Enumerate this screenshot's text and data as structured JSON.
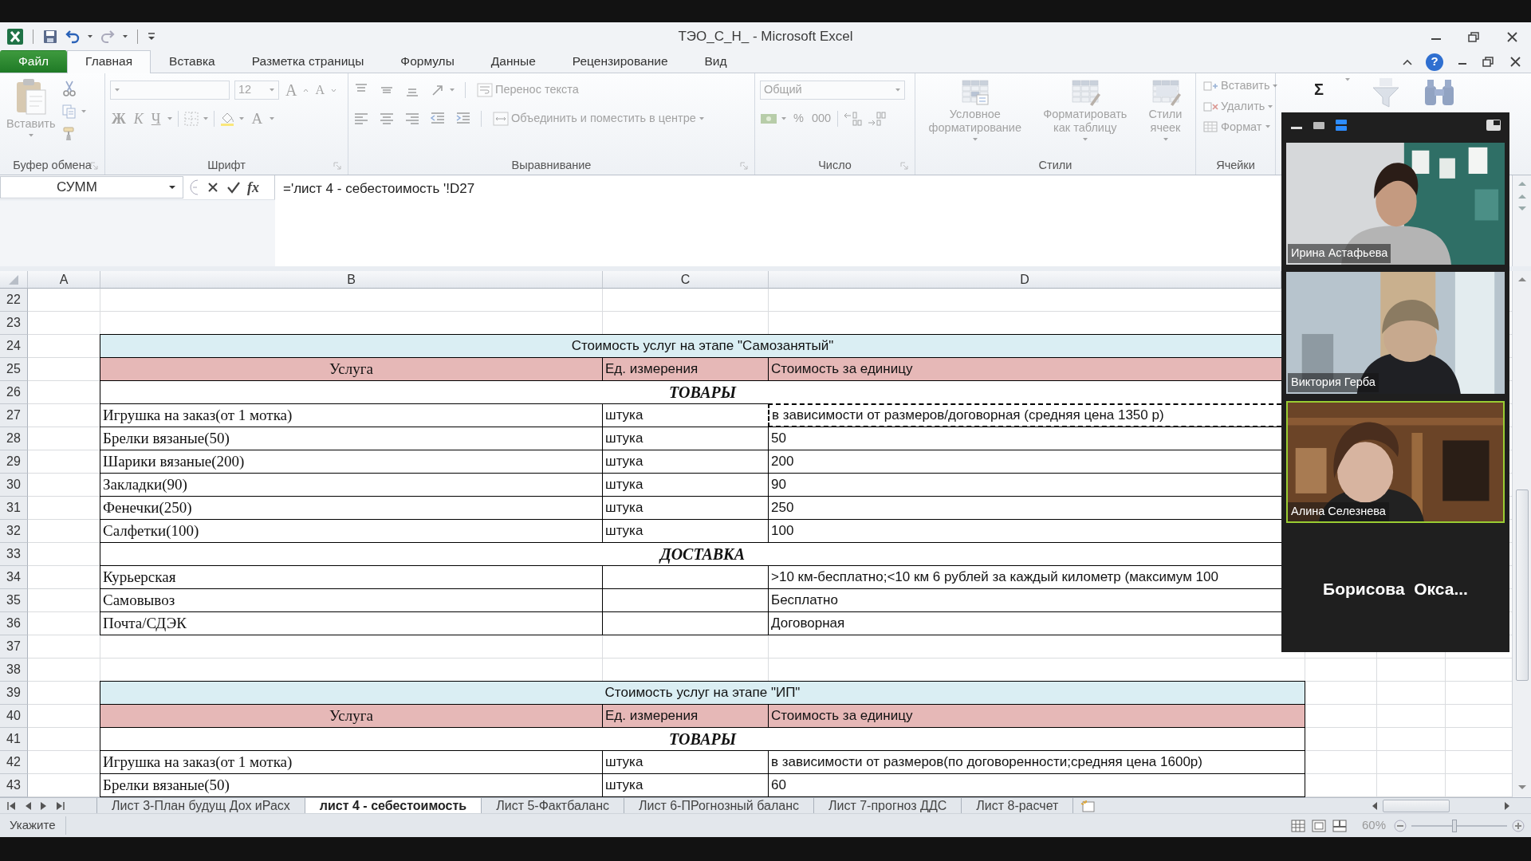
{
  "window": {
    "title": "ТЭО_С_Н_ - Microsoft Excel"
  },
  "ribbon": {
    "disabled": true,
    "help": "?",
    "tabs": [
      {
        "label": "Файл",
        "kind": "file",
        "selected": false
      },
      {
        "label": "Главная",
        "kind": "tab",
        "selected": true
      },
      {
        "label": "Вставка",
        "kind": "tab",
        "selected": false
      },
      {
        "label": "Разметка страницы",
        "kind": "tab",
        "selected": false
      },
      {
        "label": "Формулы",
        "kind": "tab",
        "selected": false
      },
      {
        "label": "Данные",
        "kind": "tab",
        "selected": false
      },
      {
        "label": "Рецензирование",
        "kind": "tab",
        "selected": false
      },
      {
        "label": "Вид",
        "kind": "tab",
        "selected": false
      }
    ],
    "groups": [
      {
        "kind": "clipboard",
        "label": "Буфер обмена",
        "items": [
          {
            "label": "Вставить"
          }
        ]
      },
      {
        "kind": "font",
        "label": "Шрифт",
        "font_size": "12",
        "buttons": [
          {
            "kind": "grow",
            "label": "A"
          },
          {
            "kind": "shrink",
            "label": "A"
          },
          {
            "kind": "bold",
            "label": "Ж"
          },
          {
            "kind": "italic",
            "label": "К"
          },
          {
            "kind": "underline",
            "label": "Ч"
          },
          {
            "kind": "color",
            "label": "A"
          }
        ]
      },
      {
        "kind": "alignment",
        "label": "Выравнивание",
        "items": [
          {
            "label": "Перенос текста"
          },
          {
            "label": "Объединить и поместить в центре"
          }
        ]
      },
      {
        "kind": "number",
        "label": "Число",
        "format": "Общий",
        "buttons": [
          {
            "label": "%"
          },
          {
            "label": "000"
          }
        ]
      },
      {
        "kind": "styles",
        "label": "Стили",
        "items": [
          {
            "label": "Условное\nформатирование"
          },
          {
            "label": "Форматировать\nкак таблицу"
          },
          {
            "label": "Стили\nячеек"
          }
        ]
      },
      {
        "kind": "cells",
        "label": "Ячейки",
        "items": [
          {
            "label": "Вставить"
          },
          {
            "label": "Удалить"
          },
          {
            "label": "Формат"
          }
        ]
      },
      {
        "kind": "editing",
        "buttons": [
          {
            "label": "Σ"
          }
        ]
      }
    ]
  },
  "formula_bar": {
    "name_box": "СУММ",
    "fx": "fx",
    "formula": "='лист 4 - себестоимость '!D27"
  },
  "sheet": {
    "columns": [
      "A",
      "B",
      "C",
      "D"
    ],
    "rows": [
      {
        "num": "22",
        "kind": "empty"
      },
      {
        "num": "23",
        "kind": "empty"
      },
      {
        "num": "24",
        "kind": "title",
        "text": "Стоимость услуг на этапе \"Самозанятый\""
      },
      {
        "num": "25",
        "kind": "header",
        "cells": [
          "Услуга",
          "Ед. измерения",
          "Стоимость за единицу"
        ]
      },
      {
        "num": "26",
        "kind": "section",
        "text": "ТОВАРЫ"
      },
      {
        "num": "27",
        "kind": "item",
        "marquee": true,
        "cells": [
          "Игрушка на заказ(от 1 мотка)",
          "штука",
          "в зависимости от размеров/договорная (средняя цена 1350 р)"
        ]
      },
      {
        "num": "28",
        "kind": "item",
        "marquee": false,
        "cells": [
          "Брелки вязаные(50)",
          "штука",
          "50"
        ]
      },
      {
        "num": "29",
        "kind": "item",
        "marquee": false,
        "cells": [
          "Шарики вязаные(200)",
          "штука",
          "200"
        ]
      },
      {
        "num": "30",
        "kind": "item",
        "marquee": false,
        "cells": [
          "Закладки(90)",
          "штука",
          "90"
        ]
      },
      {
        "num": "31",
        "kind": "item",
        "marquee": false,
        "cells": [
          "Фенечки(250)",
          "штука",
          "250"
        ]
      },
      {
        "num": "32",
        "kind": "item",
        "marquee": false,
        "cells": [
          "Салфетки(100)",
          "штука",
          "100"
        ]
      },
      {
        "num": "33",
        "kind": "section",
        "text": "ДОСТАВКА"
      },
      {
        "num": "34",
        "kind": "item",
        "marquee": false,
        "cells": [
          "Курьерская",
          "",
          ">10 км-бесплатно;<10 км 6 рублей за каждый километр (максимум 100"
        ]
      },
      {
        "num": "35",
        "kind": "item",
        "marquee": false,
        "cells": [
          "Самовывоз",
          "",
          "Бесплатно"
        ]
      },
      {
        "num": "36",
        "kind": "item",
        "marquee": false,
        "cells": [
          "Почта/СДЭК",
          "",
          "Договорная"
        ]
      },
      {
        "num": "37",
        "kind": "empty"
      },
      {
        "num": "38",
        "kind": "empty"
      },
      {
        "num": "39",
        "kind": "title",
        "text": "Стоимость услуг на этапе \"ИП\""
      },
      {
        "num": "40",
        "kind": "header",
        "cells": [
          "Услуга",
          "Ед. измерения",
          "Стоимость за единицу"
        ]
      },
      {
        "num": "41",
        "kind": "section",
        "text": "ТОВАРЫ"
      },
      {
        "num": "42",
        "kind": "item",
        "marquee": false,
        "cells": [
          "Игрушка на заказ(от 1 мотка)",
          "штука",
          "в зависимости от размеров(по договоренности;средняя цена 1600р)"
        ]
      },
      {
        "num": "43",
        "kind": "item",
        "marquee": false,
        "cells": [
          "Брелки вязаные(50)",
          "штука",
          "60"
        ]
      }
    ]
  },
  "sheet_tabs": [
    {
      "label": "Лист 3-План будущ Дох иРасх",
      "selected": false
    },
    {
      "label": "лист 4 - себестоимость",
      "selected": true
    },
    {
      "label": "Лист 5-Фактбаланс",
      "selected": false
    },
    {
      "label": "Лист 6-ПРогнозный баланс",
      "selected": false
    },
    {
      "label": "Лист 7-прогноз ДДС",
      "selected": false
    },
    {
      "label": "Лист 8-расчет",
      "selected": false
    }
  ],
  "status_bar": {
    "mode": "Укажите",
    "zoom": {
      "reading": "60%",
      "level": 0.45
    }
  },
  "participants": [
    {
      "name": "Ирина Астафьева",
      "kind": "video",
      "speaking": false
    },
    {
      "name": "Виктория Герба",
      "kind": "video",
      "speaking": false
    },
    {
      "name": "Алина Селезнева",
      "kind": "video",
      "speaking": true
    },
    {
      "name": "Борисова  Окса...",
      "kind": "name_only",
      "speaking": false
    }
  ]
}
